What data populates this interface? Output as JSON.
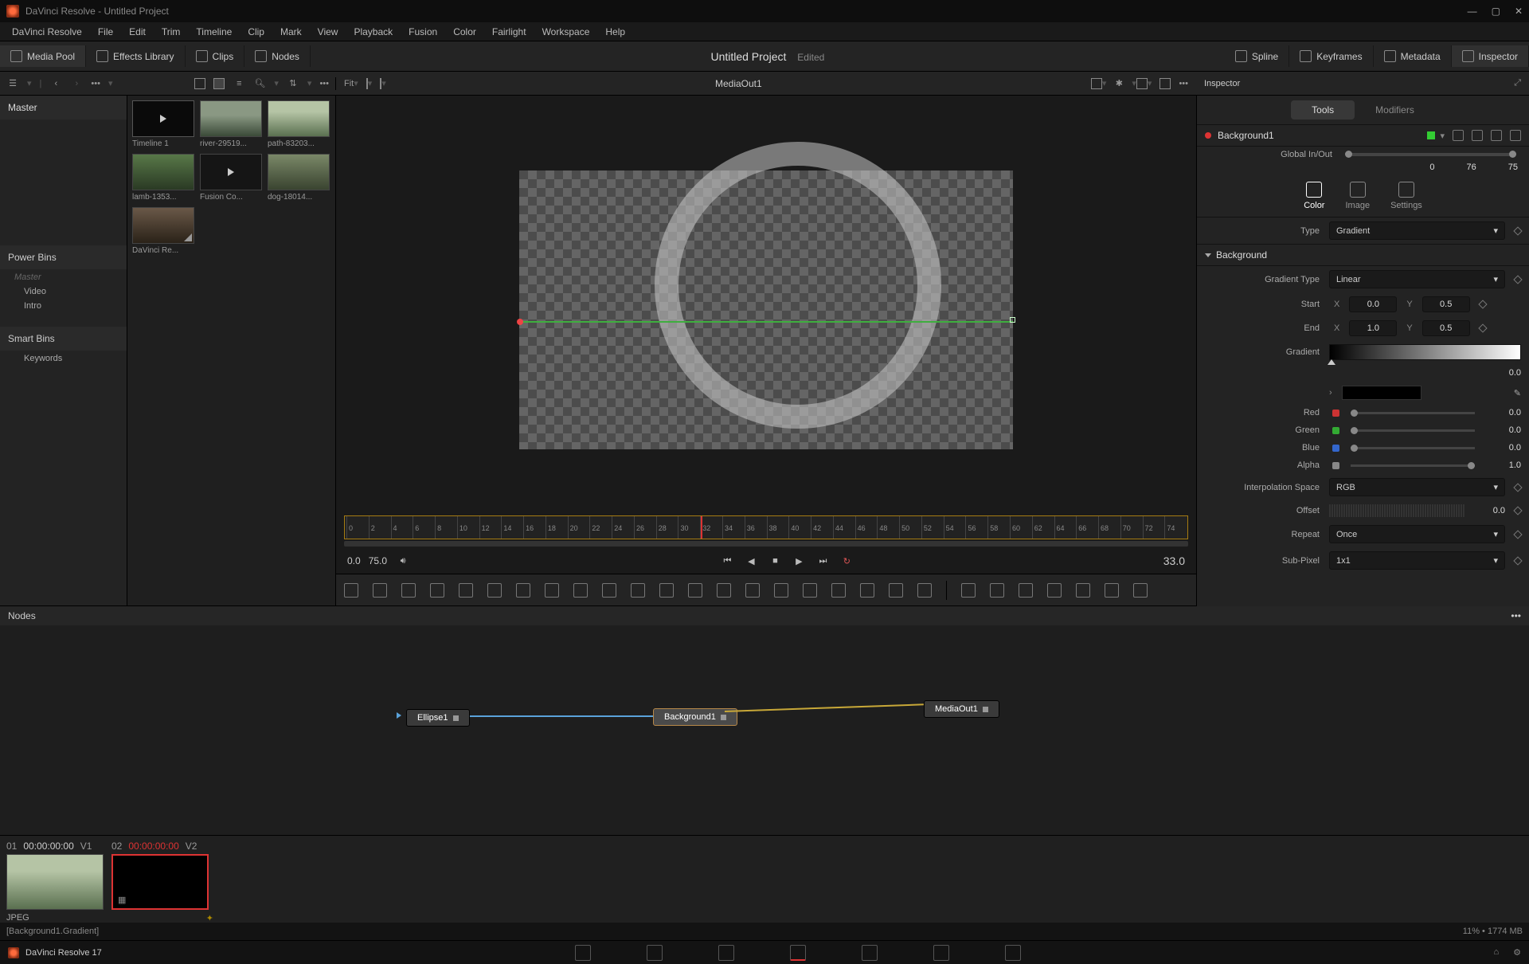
{
  "titlebar": {
    "text": "DaVinci Resolve - Untitled Project"
  },
  "menu": [
    "DaVinci Resolve",
    "File",
    "Edit",
    "Trim",
    "Timeline",
    "Clip",
    "Mark",
    "View",
    "Playback",
    "Fusion",
    "Color",
    "Fairlight",
    "Workspace",
    "Help"
  ],
  "topbar": {
    "left": [
      "Media Pool",
      "Effects Library",
      "Clips",
      "Nodes"
    ],
    "project": "Untitled Project",
    "edited": "Edited",
    "right": [
      "Spline",
      "Keyframes",
      "Metadata",
      "Inspector"
    ]
  },
  "subbar": {
    "fit": "Fit",
    "dots": "•••",
    "viewer_title": "MediaOut1",
    "inspector": "Inspector"
  },
  "sidebar": {
    "master": "Master",
    "power": "Power Bins",
    "power_items": [
      "Master",
      "Video",
      "Intro"
    ],
    "smart": "Smart Bins",
    "smart_items": [
      "Keywords"
    ]
  },
  "clips": [
    {
      "name": "Timeline 1",
      "cls": "th-tl"
    },
    {
      "name": "river-29519...",
      "cls": "th-river"
    },
    {
      "name": "path-83203...",
      "cls": "th-path"
    },
    {
      "name": "lamb-1353...",
      "cls": "th-lamb"
    },
    {
      "name": "Fusion Co...",
      "cls": "th-fcomp"
    },
    {
      "name": "dog-18014...",
      "cls": "th-dog"
    },
    {
      "name": "DaVinci Re...",
      "cls": "th-dvr"
    }
  ],
  "ruler_ticks": [
    "0",
    "2",
    "4",
    "6",
    "8",
    "10",
    "12",
    "14",
    "16",
    "18",
    "20",
    "22",
    "24",
    "26",
    "28",
    "30",
    "32",
    "34",
    "36",
    "38",
    "40",
    "42",
    "44",
    "46",
    "48",
    "50",
    "52",
    "54",
    "56",
    "58",
    "60",
    "62",
    "64",
    "66",
    "68",
    "70",
    "72",
    "74"
  ],
  "transport": {
    "start": "0.0",
    "end": "75.0",
    "cur": "33.0"
  },
  "nodes": {
    "header": "Nodes",
    "n1": "Ellipse1",
    "n2": "Background1",
    "n3": "MediaOut1"
  },
  "clipstrip": {
    "c1": {
      "idx": "01",
      "tc": "00:00:00:00",
      "ch": "V1"
    },
    "c2": {
      "idx": "02",
      "tc": "00:00:00:00",
      "ch": "V2"
    },
    "foot": "JPEG"
  },
  "status": {
    "left": "[Background1.Gradient]",
    "right": "11% • 1774 MB"
  },
  "pagebar": {
    "app": "DaVinci Resolve 17"
  },
  "inspector": {
    "tabs": [
      "Tools",
      "Modifiers"
    ],
    "node_name": "Background1",
    "global": {
      "label": "Global In/Out",
      "a": "0",
      "b": "76",
      "c": "75"
    },
    "mode_tabs": [
      "Color",
      "Image",
      "Settings"
    ],
    "type_label": "Type",
    "type_value": "Gradient",
    "section": "Background",
    "grad_type_label": "Gradient Type",
    "grad_type_value": "Linear",
    "start": {
      "label": "Start",
      "x": "0.0",
      "y": "0.5"
    },
    "end": {
      "label": "End",
      "x": "1.0",
      "y": "0.5"
    },
    "gradient_label": "Gradient",
    "gradient_val": "0.0",
    "red": {
      "label": "Red",
      "val": "0.0",
      "color": "#c33"
    },
    "green": {
      "label": "Green",
      "val": "0.0",
      "color": "#3a3"
    },
    "blue": {
      "label": "Blue",
      "val": "0.0",
      "color": "#36c"
    },
    "alpha": {
      "label": "Alpha",
      "val": "1.0",
      "color": "#888"
    },
    "interp": {
      "label": "Interpolation Space",
      "val": "RGB"
    },
    "offset": {
      "label": "Offset",
      "val": "0.0"
    },
    "repeat": {
      "label": "Repeat",
      "val": "Once"
    },
    "subpixel": {
      "label": "Sub-Pixel",
      "val": "1x1"
    }
  }
}
